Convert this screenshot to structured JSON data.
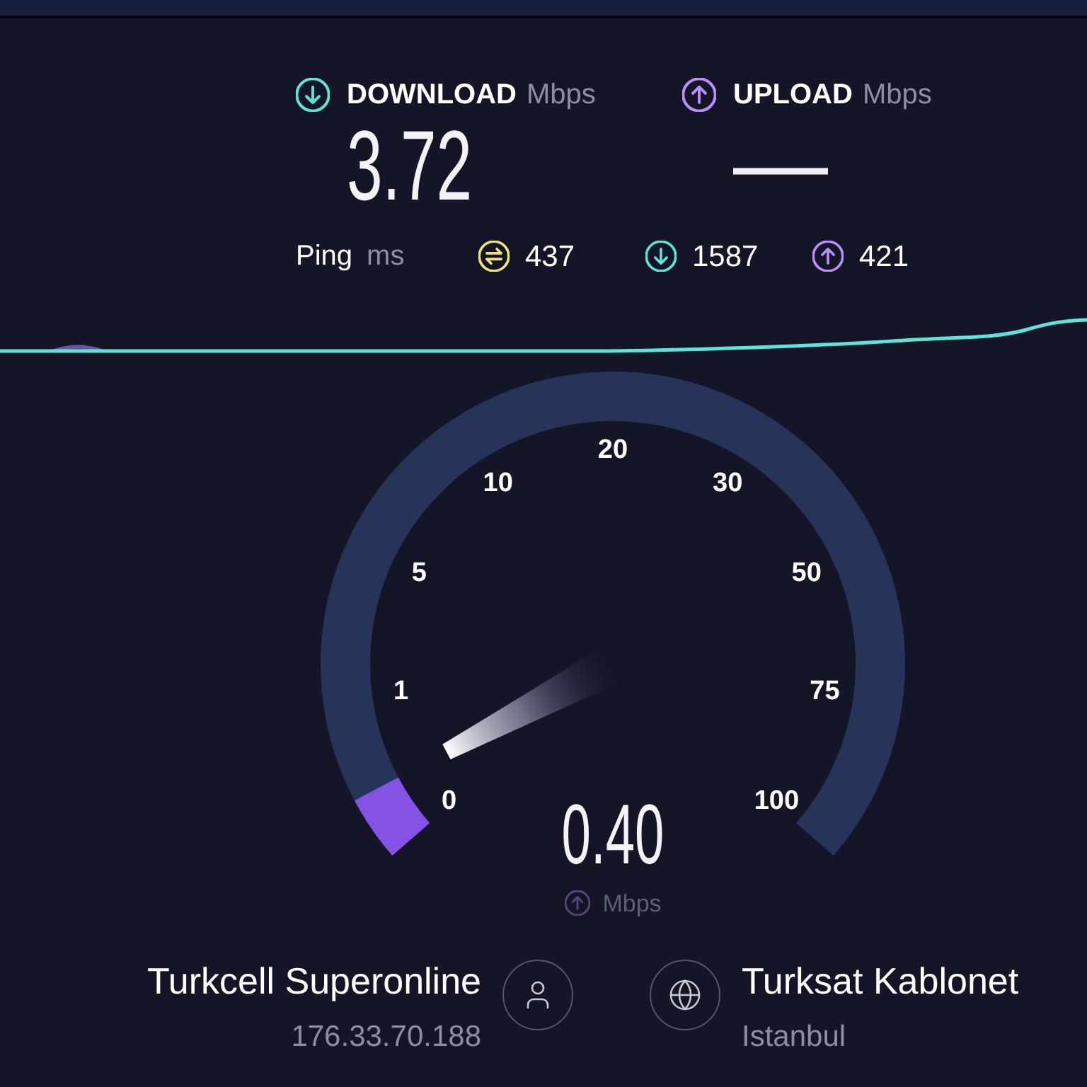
{
  "results": [
    {
      "kind": "download",
      "label": "DOWNLOAD",
      "unit": "Mbps",
      "value": "3.72"
    },
    {
      "kind": "upload",
      "label": "UPLOAD",
      "unit": "Mbps",
      "value": "—"
    }
  ],
  "ping": {
    "label": "Ping",
    "unit": "ms",
    "stats": [
      {
        "kind": "jitter",
        "value": "437"
      },
      {
        "kind": "download",
        "value": "1587"
      },
      {
        "kind": "upload",
        "value": "421"
      }
    ]
  },
  "gauge": {
    "ticks": [
      "0",
      "1",
      "5",
      "10",
      "20",
      "30",
      "50",
      "75",
      "100"
    ],
    "level": 0.05,
    "value": "0.40",
    "kind": "upload",
    "unit": "Mbps"
  },
  "provider": {
    "name": "Turkcell Superonline",
    "ip": "176.33.70.188"
  },
  "server": {
    "name": "Turksat Kablonet",
    "location": "Istanbul"
  }
}
